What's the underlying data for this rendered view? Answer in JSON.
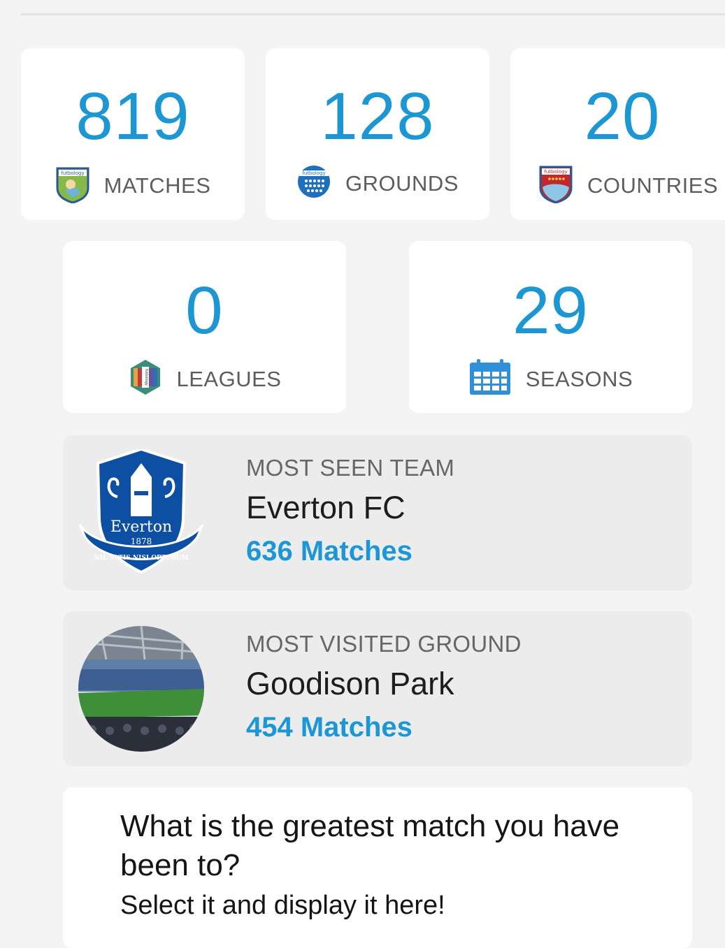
{
  "stats": {
    "matches": {
      "value": "819",
      "label": "MATCHES",
      "icon": "futbology-matches-badge-icon"
    },
    "grounds": {
      "value": "128",
      "label": "GROUNDS",
      "icon": "futbology-grounds-badge-icon"
    },
    "countries": {
      "value": "20",
      "label": "COUNTRIES",
      "icon": "futbology-countries-badge-icon"
    },
    "leagues": {
      "value": "0",
      "label": "LEAGUES",
      "icon": "futbology-leagues-badge-icon"
    },
    "seasons": {
      "value": "29",
      "label": "SEASONS",
      "icon": "calendar-icon"
    }
  },
  "badge_text": {
    "futbology": "futbology",
    "club_name": "Everton",
    "club_year": "1878",
    "club_motto": "NIL SATIS NISI OPTIMUM"
  },
  "most_seen_team": {
    "kicker": "MOST SEEN TEAM",
    "name": "Everton FC",
    "count": "636 Matches"
  },
  "most_visited_ground": {
    "kicker": "MOST VISITED GROUND",
    "name": "Goodison Park",
    "count": "454 Matches"
  },
  "prompt": {
    "question": "What is the greatest match you have been to?",
    "subtitle": "Select it and display it here!"
  },
  "colors": {
    "accent": "#1c97d4",
    "everton_blue": "#0d4fa3",
    "pitch_green": "#3f8f3a"
  }
}
